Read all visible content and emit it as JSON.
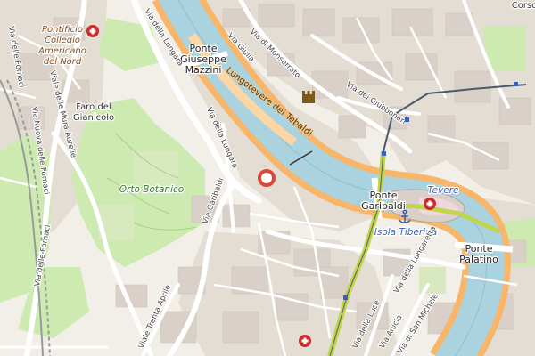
{
  "labels": {
    "pontificio_1": "Pontificio",
    "pontificio_2": "Collegio",
    "pontificio_3": "Americano",
    "pontificio_4": "del Nord",
    "ponte_mazzini_1": "Ponte",
    "ponte_mazzini_2": "Giuseppe",
    "ponte_mazzini_3": "Mazzini",
    "faro_1": "Faro del",
    "faro_2": "Gianicolo",
    "orto": "Orto Botanico",
    "ponte_garibaldi_1": "Ponte",
    "ponte_garibaldi_2": "Garibaldi",
    "isola": "Isola Tiberina",
    "ponte_palatino_1": "Ponte",
    "ponte_palatino_2": "Palatino",
    "tevere": "Tevere",
    "corso": "Corso"
  },
  "streets": {
    "lungotevere": "Lungotevere dei Tebaldi",
    "via_lungara_top": "Via della Lungara",
    "via_lungara_mid": "Via della Lungara",
    "via_giulia": "Via Giulia",
    "via_monserrato": "Via di Monserrato",
    "via_giubbonari": "Via dei Giubbonari",
    "via_garibaldi": "Via Garibaldi",
    "via_fornaci_top": "Via delle Fornaci",
    "via_nuova_fornaci": "Via Nuova delle Fornaci",
    "via_mura_aurelie": "Viale delle Mura Aurelie",
    "via_fornaci_bottom": "Via delle Fornaci",
    "viale_trenta_aprile": "Viale Trenta Aprile",
    "via_luce": "Via della Luce",
    "via_anicia": "Via Anicia",
    "via_michele": "Via di San Michele",
    "via_lungaretta": "Via della Lungaretta"
  },
  "markers": {
    "location_pin": "location-pin",
    "hospital_top": "hospital-icon",
    "hospital_island": "hospital-icon",
    "hospital_bottom": "hospital-icon",
    "castle": "castle-icon",
    "anchor": "anchor-icon"
  },
  "colors": {
    "background": "#f2efe9",
    "river": "#aad3df",
    "river_embankment": "#f7b66a",
    "park": "#cdebb0",
    "block": "#e0dad0",
    "building": "#d9d0c9",
    "road": "#ffffff",
    "rail_tram": "#bfd64b",
    "pin": "#d9483b",
    "hospital": "#cc2a2a"
  }
}
